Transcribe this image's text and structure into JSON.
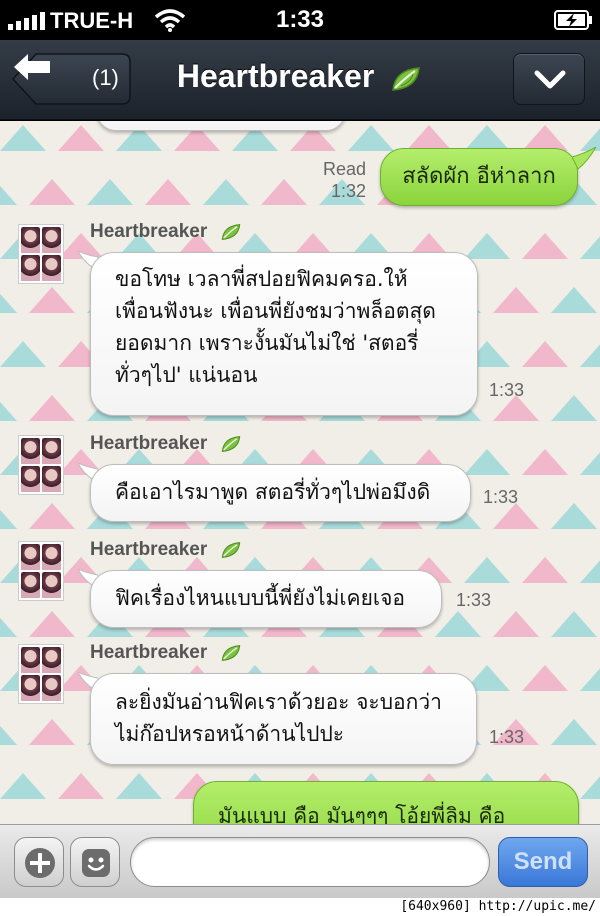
{
  "status_bar": {
    "carrier": "TRUE-H",
    "time": "1:33"
  },
  "nav": {
    "back_count": "(1)",
    "title": "Heartbreaker",
    "title_icon": "leaf-icon",
    "menu_icon": "chevron-down-icon"
  },
  "messages": [
    {
      "direction": "out",
      "text": "สลัดผัก อีห่าลาก",
      "read_label": "Read",
      "time": "1:32"
    },
    {
      "direction": "in",
      "sender": "Heartbreaker",
      "lines": [
        "ขอโทษ เวลาพี่สปอยฟิคมครอ.ให้",
        "เพื่อนฟังนะ เพื่อนพี่ยังชมว่าพล็อตสุด",
        "ยอดมาก เพราะงั้นมันไม่ใช่ 'สตอรี่",
        "ทั่วๆไป' แน่นอน"
      ],
      "time": "1:33"
    },
    {
      "direction": "in",
      "sender": "Heartbreaker",
      "lines": [
        "คือเอาไรมาพูด สตอรี่ทั่วๆไปพ่อมึงดิ"
      ],
      "time": "1:33"
    },
    {
      "direction": "in",
      "sender": "Heartbreaker",
      "lines": [
        "ฟิคเรื่องไหนแบบนี้พี่ยังไม่เคยเจอ"
      ],
      "time": "1:33"
    },
    {
      "direction": "in",
      "sender": "Heartbreaker",
      "lines": [
        "ละยิ่งมันอ่านฟิคเราด้วยอะ จะบอกว่า",
        "ไม่ก๊อปหรอหน้าด้านไปปะ"
      ],
      "time": "1:33"
    },
    {
      "direction": "out",
      "text": "มันแบบ คือ มันๆๆๆ โอ้ยพี่ลิม คือ"
    }
  ],
  "input_bar": {
    "add_icon": "plus-icon",
    "sticker_icon": "smiley-icon",
    "placeholder": "",
    "send_label": "Send"
  },
  "footer": {
    "watermark": "[640x960] http://upic.me/"
  },
  "colors": {
    "nav_bar": "#1c222a",
    "out_bubble": "#8bd43c",
    "in_bubble": "#ffffff",
    "send_button": "#3a78d8",
    "pattern_pink": "#f0a6c2",
    "pattern_teal": "#8fd4d6"
  }
}
